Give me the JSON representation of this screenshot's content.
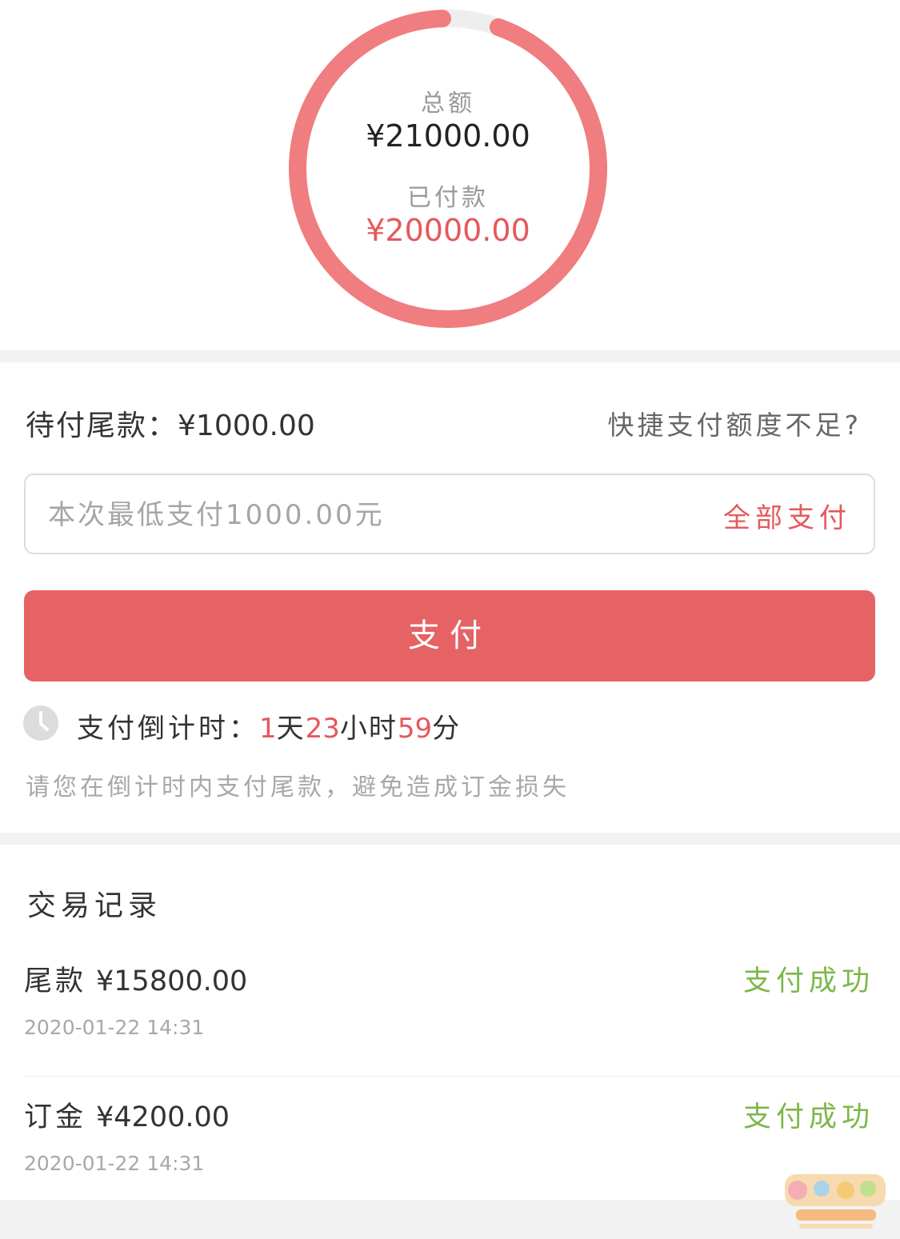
{
  "summary": {
    "total_label": "总额",
    "total_value": "¥21000.00",
    "paid_label": "已付款",
    "paid_value": "¥20000.00",
    "paid_fraction": 0.952,
    "ring_color": "#f07d7f",
    "ring_track_color": "#eeeeee"
  },
  "payment": {
    "remaining_label": "待付尾款：",
    "remaining_amount": "¥1000.00",
    "quota_link": "快捷支付额度不足?",
    "amount_placeholder": "本次最低支付1000.00元",
    "pay_all_label": "全部支付",
    "pay_button_label": "支付",
    "countdown": {
      "label": "支付倒计时：",
      "days": "1",
      "days_unit": "天",
      "hours": "23",
      "hours_unit": "小时",
      "minutes": "59",
      "minutes_unit": "分",
      "icon": "clock-icon"
    },
    "warning_text": "请您在倒计时内支付尾款，避免造成订金损失"
  },
  "records": {
    "title": "交易记录",
    "items": [
      {
        "kind": "尾款",
        "amount": "¥15800.00",
        "time": "2020-01-22 14:31",
        "status": "支付成功"
      },
      {
        "kind": "订金",
        "amount": "¥4200.00",
        "time": "2020-01-22 14:31",
        "status": "支付成功"
      }
    ]
  },
  "colors": {
    "accent": "#e5585c",
    "button": "#e56365",
    "success": "#7cb747"
  }
}
